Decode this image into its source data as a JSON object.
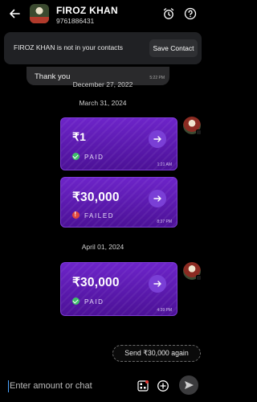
{
  "header": {
    "contact_name": "FIROZ KHAN",
    "phone": "9761886431",
    "icons": [
      "back-arrow-icon",
      "alarm-clock-icon",
      "help-icon"
    ]
  },
  "banner": {
    "text": "FIROZ KHAN is not in your contacts",
    "save_label": "Save Contact"
  },
  "messages": [
    {
      "text": "Thank you",
      "time": "5:22 PM"
    }
  ],
  "dates": [
    "December 27, 2022",
    "March 31, 2024",
    "April 01, 2024"
  ],
  "payments": [
    {
      "amount": "₹1",
      "status": "PAID",
      "time": "1:21 AM"
    },
    {
      "amount": "₹30,000",
      "status": "FAILED",
      "time": "8:37 PM"
    },
    {
      "amount": "₹30,000",
      "status": "PAID",
      "time": "4:39 PM"
    }
  ],
  "send_again_label": "Send ₹30,000 again",
  "input": {
    "placeholder": "Enter amount or chat"
  },
  "colors": {
    "card_purple": "#5a1ab0",
    "paid_green": "#3fbf6a",
    "failed_red": "#e0473c"
  }
}
